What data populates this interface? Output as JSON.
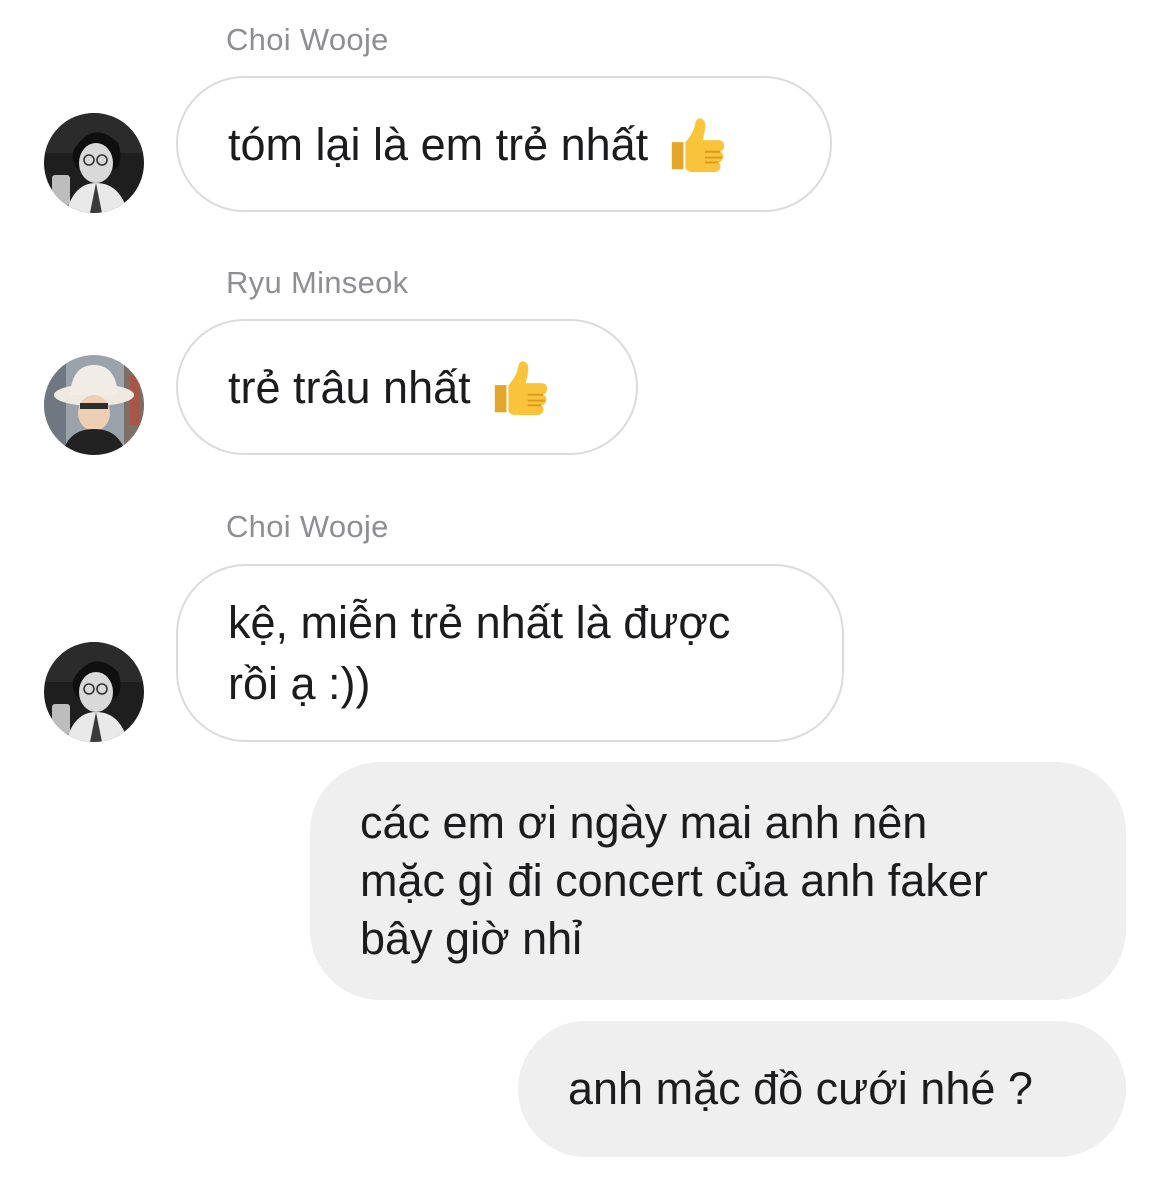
{
  "conversation": {
    "messages": [
      {
        "sender": "Choi Wooje",
        "direction": "incoming",
        "avatar_icon": "avatar-choi-wooje",
        "text": "tóm lại là em trẻ nhất",
        "emoji_icon": "thumbs-up-icon"
      },
      {
        "sender": "Ryu Minseok",
        "direction": "incoming",
        "avatar_icon": "avatar-ryu-minseok",
        "text": "trẻ trâu nhất",
        "emoji_icon": "thumbs-up-icon"
      },
      {
        "sender": "Choi Wooje",
        "direction": "incoming",
        "avatar_icon": "avatar-choi-wooje",
        "text": "kệ, miễn trẻ nhất là được\nrồi ạ :))"
      },
      {
        "direction": "outgoing",
        "text": "các em ơi ngày mai anh nên\nmặc gì đi concert của anh faker\nbây giờ nhỉ"
      },
      {
        "direction": "outgoing",
        "text": "anh mặc đồ cưới nhé ?"
      }
    ]
  },
  "colors": {
    "incoming_bubble_border": "#dbdbdb",
    "outgoing_bubble_bg": "#efefef",
    "sender_name": "#8e8e93",
    "text": "#1c1c1e",
    "thumb_emoji": "#f9c43a"
  }
}
